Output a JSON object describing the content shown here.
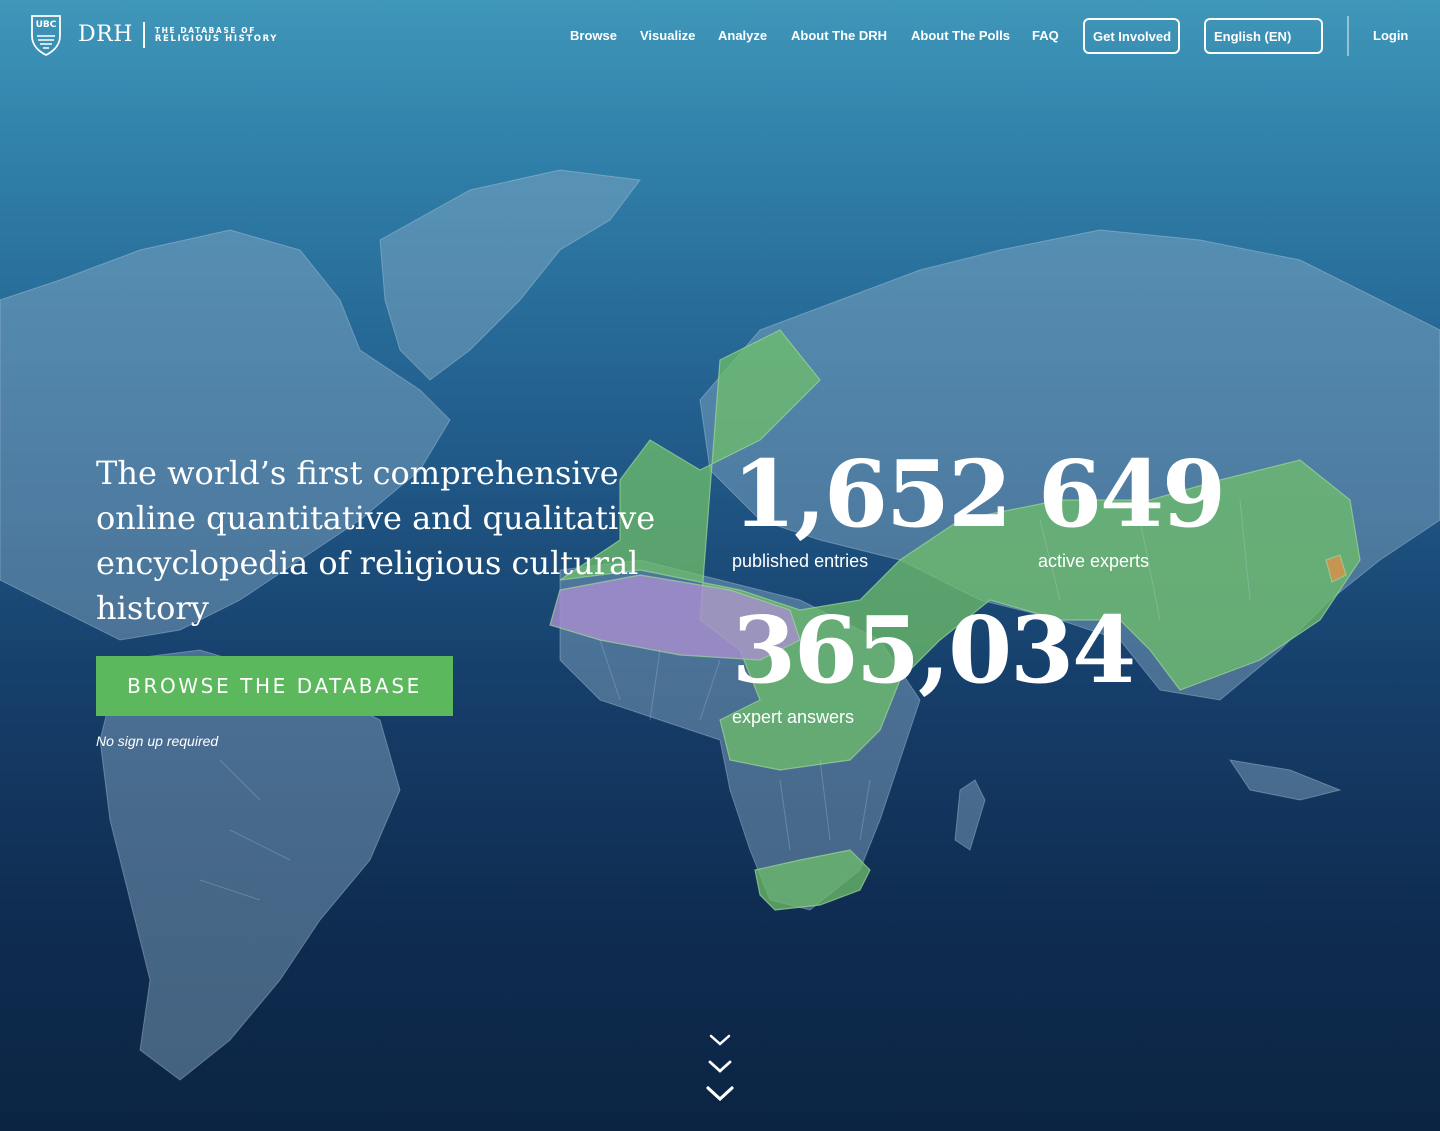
{
  "header": {
    "logo": {
      "shield_text": "UBC",
      "brand": "DRH",
      "subtitle_small": "THE DATABASE OF",
      "subtitle_big": "RELIGIOUS HISTORY"
    },
    "nav": [
      {
        "label": "Browse"
      },
      {
        "label": "Visualize"
      },
      {
        "label": "Analyze"
      },
      {
        "label": "About The DRH"
      },
      {
        "label": "About The Polls"
      },
      {
        "label": "FAQ"
      }
    ],
    "get_involved": "Get Involved",
    "language": "English (EN)",
    "login": "Login"
  },
  "hero": {
    "headline": "The world’s first comprehensive online quantitative and qualitative encyclopedia of religious cultural history",
    "cta": "Browse the Database",
    "note": "No sign up required"
  },
  "stats": [
    {
      "value": "1,652",
      "label": "published entries"
    },
    {
      "value": "649",
      "label": "active experts"
    },
    {
      "value": "365,034",
      "label": "expert answers"
    }
  ],
  "colors": {
    "accent_green": "#5cb85c",
    "region_green": "#6fbf6a",
    "region_purple": "#a98fcf",
    "bg_top": "#3f97b9",
    "bg_bottom": "#0b2442"
  },
  "icons": {
    "logo": "ubc-shield-icon",
    "scroll": "chevron-down-icon"
  }
}
